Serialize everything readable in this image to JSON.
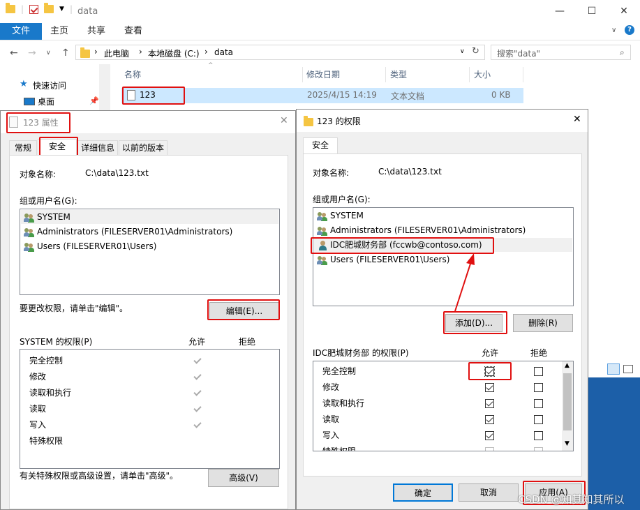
{
  "explorer": {
    "title": "data",
    "file_tab": "文件",
    "tabs": [
      "主页",
      "共享",
      "查看"
    ],
    "breadcrumb": [
      "此电脑",
      "本地磁盘 (C:)",
      "data"
    ],
    "search_placeholder": "搜索\"data\"",
    "nav": [
      "快速访问",
      "桌面"
    ],
    "columns": [
      "名称",
      "修改日期",
      "类型",
      "大小"
    ],
    "file": {
      "name": "123",
      "modified": "2025/4/15 14:19",
      "type": "文本文档",
      "size": "0 KB"
    }
  },
  "props": {
    "title": "123 属性",
    "tabs": [
      "常规",
      "安全",
      "详细信息",
      "以前的版本"
    ],
    "object_label": "对象名称:",
    "object_value": "C:\\data\\123.txt",
    "group_label": "组或用户名(G):",
    "users": [
      "SYSTEM",
      "Administrators (FILESERVER01\\Administrators)",
      "Users (FILESERVER01\\Users)"
    ],
    "change_hint": "要更改权限，请单击\"编辑\"。",
    "edit_button": "编辑(E)...",
    "perm_header": "SYSTEM 的权限(P)",
    "allow": "允许",
    "deny": "拒绝",
    "perms": [
      "完全控制",
      "修改",
      "读取和执行",
      "读取",
      "写入",
      "特殊权限"
    ],
    "advanced_hint": "有关特殊权限或高级设置，请单击\"高级\"。",
    "advanced_button": "高级(V)"
  },
  "perm_dialog": {
    "title": "123 的权限",
    "tab": "安全",
    "object_label": "对象名称:",
    "object_value": "C:\\data\\123.txt",
    "group_label": "组或用户名(G):",
    "users": [
      "SYSTEM",
      "Administrators (FILESERVER01\\Administrators)",
      "IDC肥城财务部 (fccwb@contoso.com)",
      "Users (FILESERVER01\\Users)"
    ],
    "add_button": "添加(D)...",
    "remove_button": "删除(R)",
    "perm_header": "IDC肥城财务部 的权限(P)",
    "allow": "允许",
    "deny": "拒绝",
    "perms": [
      "完全控制",
      "修改",
      "读取和执行",
      "读取",
      "写入",
      "特殊权限"
    ],
    "ok_button": "确定",
    "cancel_button": "取消",
    "apply_button": "应用(A)"
  },
  "watermark": "CSDN @知其知其所以",
  "colors": {
    "accent": "#0078d7",
    "highlight": "#e01010",
    "file_tab": "#1979ca",
    "selection": "#cce8ff"
  }
}
